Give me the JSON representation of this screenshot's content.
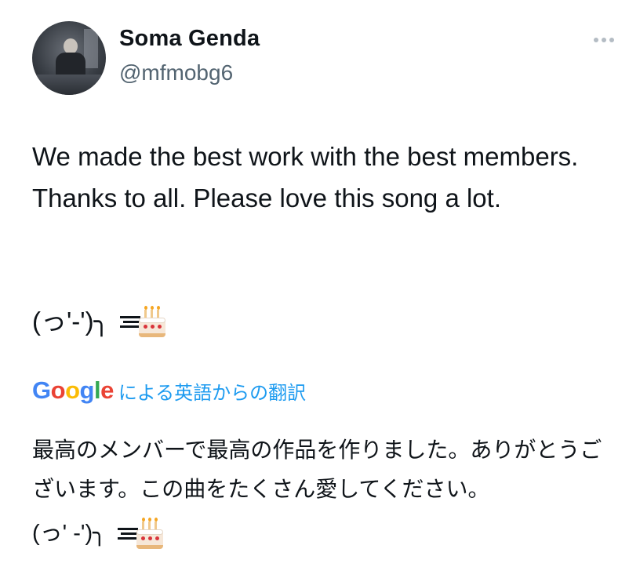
{
  "author": {
    "name": "Soma Genda",
    "handle": "@mfmobg6",
    "avatar": "avatar-photo"
  },
  "more_menu_icon": "more-horizontal-icon",
  "tweet": {
    "text": "We made the best work with the best members. Thanks to all. Please love this song a lot.",
    "kaomoji": "(っ'-')╮",
    "emoji": "cake-icon"
  },
  "translation": {
    "provider_letters": [
      "G",
      "o",
      "o",
      "g",
      "l",
      "e"
    ],
    "provider_colors": [
      "#4285F4",
      "#EA4335",
      "#FBBC05",
      "#4285F4",
      "#34A853",
      "#EA4335"
    ],
    "label": "による英語からの翻訳",
    "text": "最高のメンバーで最高の作品を作りました。ありがとうございます。この曲をたくさん愛してください。",
    "kaomoji": "(っ' -')╮"
  },
  "colors": {
    "text": "#0f1419",
    "muted": "#536471",
    "link": "#1d9bf0"
  }
}
